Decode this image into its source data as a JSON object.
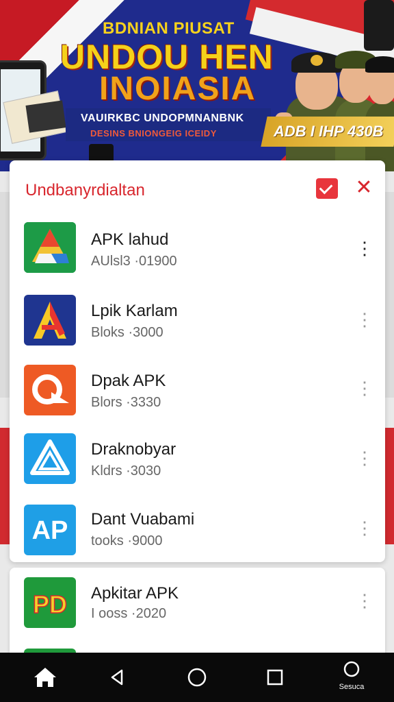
{
  "banner": {
    "line1": "BDNIAN PIUSAT",
    "line2": "UNDOU HEN",
    "line3": "INOIASIA",
    "line4": "VAUIRKBC UNDOPMNANBNK",
    "line5": "DESINS BNIONGEIG ICEIDY",
    "price": "ADB I IHP 430B"
  },
  "panel": {
    "title": "Undbanyrdialtan",
    "items": [
      {
        "name": "APK lahud",
        "meta": "AUlsl3 ·01900",
        "icon": "drive-style-triangle-icon"
      },
      {
        "name": "Lpik Karlam",
        "meta": "Bloks ·3000",
        "icon": "letter-a-icon"
      },
      {
        "name": "Dpak APK",
        "meta": "Blors ·3330",
        "icon": "orange-q-icon"
      },
      {
        "name": "Draknobyar",
        "meta": "Kldrs ·3030",
        "icon": "blue-triangle-icon"
      },
      {
        "name": "Dant Vuabami",
        "meta": "tooks ·9000",
        "icon": "ap-icon"
      }
    ]
  },
  "card2": {
    "items": [
      {
        "name": "Apkitar APK",
        "meta": "I ooss ·2020",
        "icon": "pd-icon"
      }
    ]
  },
  "nav": {
    "last_label": "Sesuca"
  },
  "colors": {
    "accent": "#d8262d",
    "navbar": "#0a0a0a"
  }
}
